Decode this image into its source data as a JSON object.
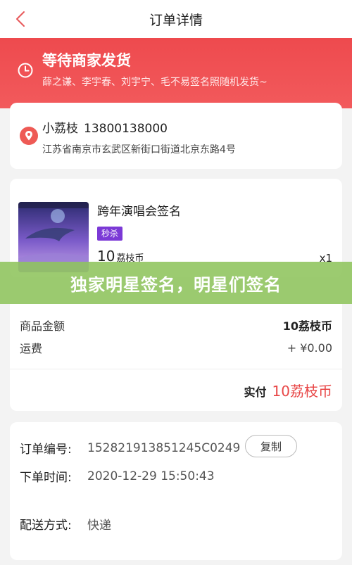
{
  "header": {
    "title": "订单详情"
  },
  "status": {
    "title": "等待商家发货",
    "subtitle": "薛之谦、李宇春、刘宇宁、毛不易签名照随机发货~"
  },
  "address": {
    "name": "小荔枝",
    "phone": "13800138000",
    "line": "江苏省南京市玄武区新街口街道北京东路4号"
  },
  "item": {
    "title": "跨年演唱会签名",
    "tag": "秒杀",
    "price": "10",
    "unit": "荔枝币",
    "qty": "x1"
  },
  "overlay": {
    "text": "独家明星签名，明星们签名"
  },
  "amounts": {
    "goods_label": "商品金额",
    "goods_value": "10荔枝币",
    "shipping_label": "运费",
    "shipping_value": "+ ¥0.00",
    "paid_label": "实付",
    "paid_value": "10荔枝币"
  },
  "order_info": {
    "number_label": "订单编号:",
    "number_value": "152821913851245C0249",
    "copy_label": "复制",
    "time_label": "下单时间:",
    "time_value": "2020-12-29 15:50:43",
    "delivery_label": "配送方式:",
    "delivery_value": "快递"
  },
  "colors": {
    "accent_red": "#ee4a4e",
    "price_red": "#e84646",
    "tag_purple": "#7b39d6",
    "overlay_green": "#8ec45c"
  }
}
